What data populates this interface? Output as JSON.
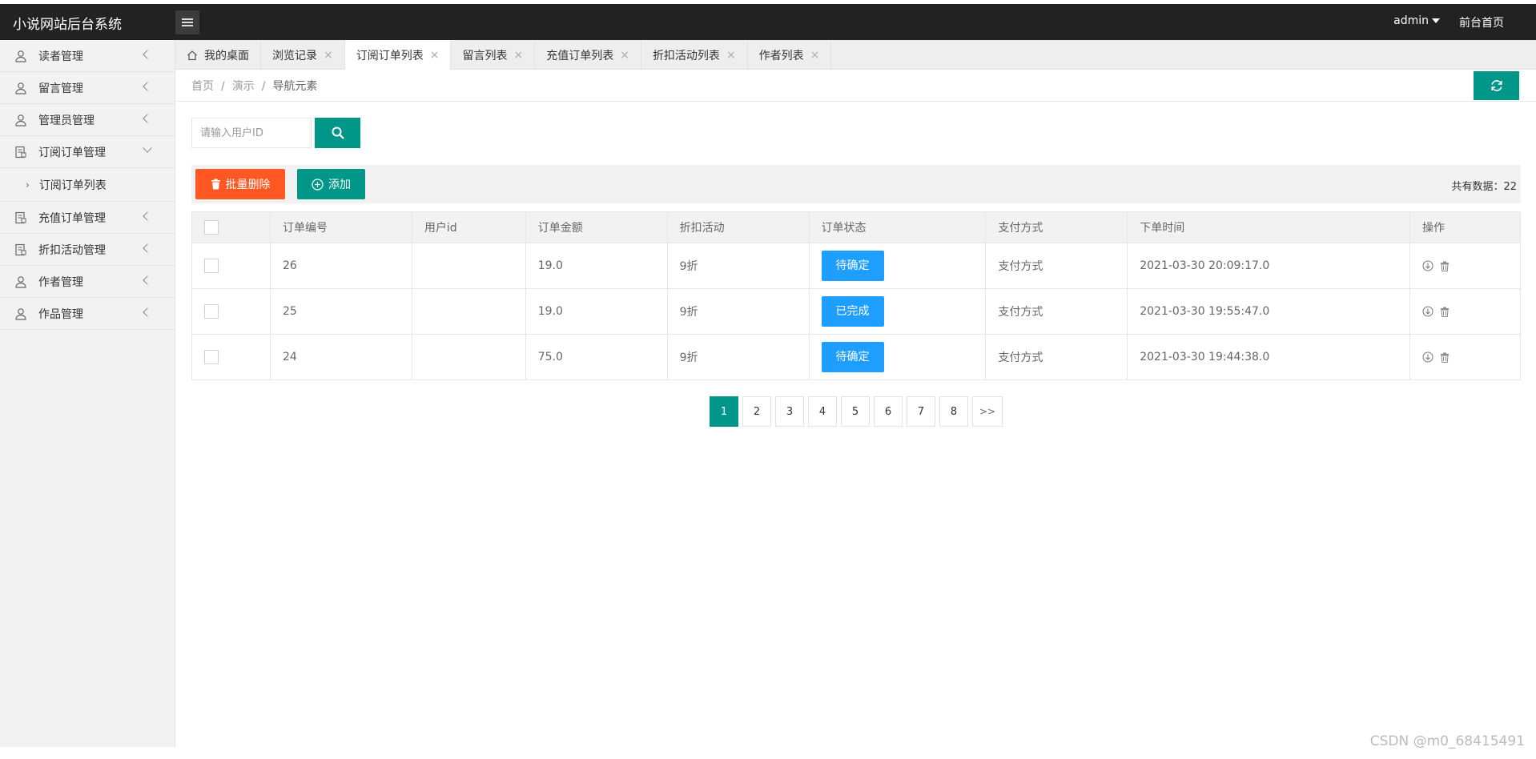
{
  "app": {
    "title": "小说网站后台系统",
    "user": "admin",
    "front_link": "前台首页"
  },
  "sidebar": {
    "items": [
      {
        "label": "读者管理",
        "icon": "user-icon"
      },
      {
        "label": "留言管理",
        "icon": "user-icon"
      },
      {
        "label": "管理员管理",
        "icon": "user-icon"
      },
      {
        "label": "订阅订单管理",
        "icon": "document-icon",
        "expanded": true
      },
      {
        "label": "充值订单管理",
        "icon": "document-icon"
      },
      {
        "label": "折扣活动管理",
        "icon": "document-icon"
      },
      {
        "label": "作者管理",
        "icon": "user-icon"
      },
      {
        "label": "作品管理",
        "icon": "user-icon"
      }
    ],
    "subitem": "订阅订单列表"
  },
  "tabs": [
    {
      "label": "我的桌面",
      "active": false,
      "closable": false
    },
    {
      "label": "浏览记录",
      "active": false,
      "closable": true
    },
    {
      "label": "订阅订单列表",
      "active": true,
      "closable": true
    },
    {
      "label": "留言列表",
      "active": false,
      "closable": true
    },
    {
      "label": "充值订单列表",
      "active": false,
      "closable": true
    },
    {
      "label": "折扣活动列表",
      "active": false,
      "closable": true
    },
    {
      "label": "作者列表",
      "active": false,
      "closable": true
    }
  ],
  "tab_close": "×",
  "breadcrumb": {
    "items": [
      "首页",
      "演示",
      "导航元素"
    ],
    "sep": "/"
  },
  "search": {
    "placeholder": "请输入用户ID",
    "value": ""
  },
  "toolbar": {
    "delete_label": "批量删除",
    "add_label": "添加",
    "total_label": "共有数据：22"
  },
  "table": {
    "headers": [
      "订单编号",
      "用户id",
      "订单金额",
      "折扣活动",
      "订单状态",
      "支付方式",
      "下单时间",
      "操作"
    ],
    "rows": [
      {
        "id": "26",
        "user": "",
        "amount": "19.0",
        "discount": "9折",
        "status": "待确定",
        "pay": "支付方式",
        "time": "2021-03-30 20:09:17.0"
      },
      {
        "id": "25",
        "user": "",
        "amount": "19.0",
        "discount": "9折",
        "status": "已完成",
        "pay": "支付方式",
        "time": "2021-03-30 19:55:47.0"
      },
      {
        "id": "24",
        "user": "",
        "amount": "75.0",
        "discount": "9折",
        "status": "待确定",
        "pay": "支付方式",
        "time": "2021-03-30 19:44:38.0"
      }
    ]
  },
  "pagination": {
    "pages": [
      "1",
      "2",
      "3",
      "4",
      "5",
      "6",
      "7",
      "8"
    ],
    "current": "1",
    "next": ">>"
  },
  "watermark": "CSDN @m0_68415491",
  "colors": {
    "topbar": "#222222",
    "primary": "#009688",
    "danger": "#ff5722",
    "status": "#1e9fff"
  }
}
